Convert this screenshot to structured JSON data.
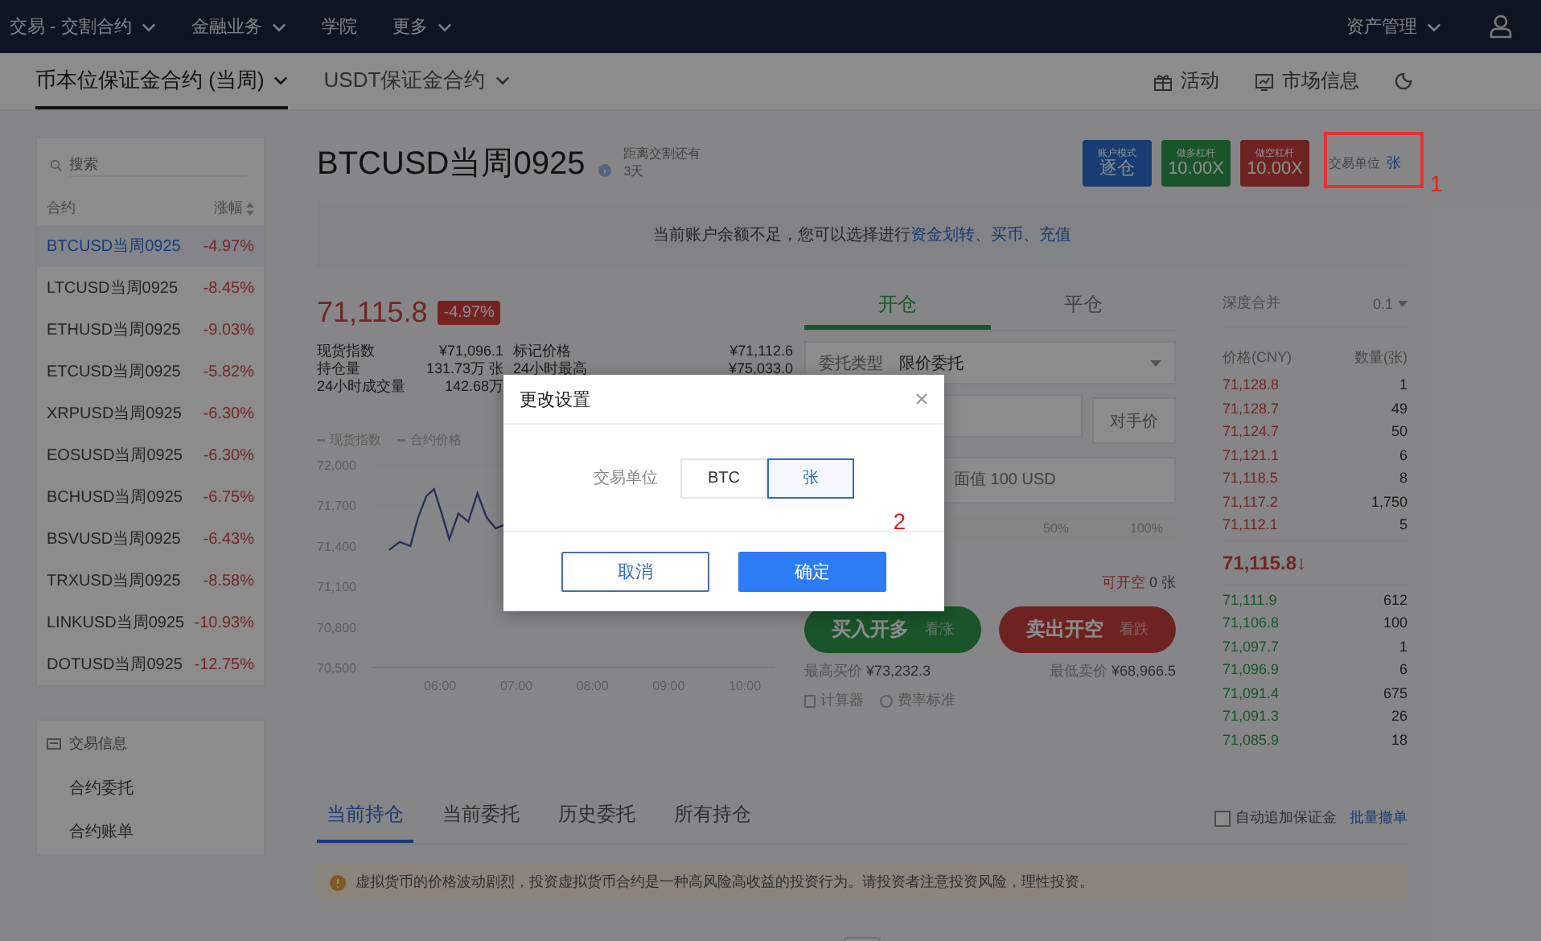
{
  "top_nav": {
    "items": [
      {
        "label": "交易 - 交割合约",
        "dropdown": true
      },
      {
        "label": "金融业务",
        "dropdown": true
      },
      {
        "label": "学院",
        "dropdown": false
      },
      {
        "label": "更多",
        "dropdown": true
      }
    ],
    "account": {
      "label": "资产管理",
      "dropdown": true
    }
  },
  "sub_nav": {
    "tabs": [
      {
        "label": "币本位保证金合约 (当周)",
        "selected": true,
        "dropdown": true
      },
      {
        "label": "USDT保证金合约",
        "selected": false,
        "dropdown": true
      }
    ],
    "links": [
      {
        "label": "活动",
        "kind": "gift"
      },
      {
        "label": "市场信息",
        "kind": "chart"
      }
    ]
  },
  "sidebar": {
    "search": {
      "placeholder": "搜索"
    },
    "columns": [
      "合约",
      "涨幅"
    ],
    "contracts": [
      {
        "name": "BTCUSD当周0925",
        "change": "-4.97%",
        "selected": true
      },
      {
        "name": "LTCUSD当周0925",
        "change": "-8.45%",
        "selected": false
      },
      {
        "name": "ETHUSD当周0925",
        "change": "-9.03%",
        "selected": false
      },
      {
        "name": "ETCUSD当周0925",
        "change": "-5.82%",
        "selected": false
      },
      {
        "name": "XRPUSD当周0925",
        "change": "-6.30%",
        "selected": false
      },
      {
        "name": "EOSUSD当周0925",
        "change": "-6.30%",
        "selected": false
      },
      {
        "name": "BCHUSD当周0925",
        "change": "-6.75%",
        "selected": false
      },
      {
        "name": "BSVUSD当周0925",
        "change": "-6.43%",
        "selected": false
      },
      {
        "name": "TRXUSD当周0925",
        "change": "-8.58%",
        "selected": false
      },
      {
        "name": "LINKUSD当周0925",
        "change": "-10.93%",
        "selected": false
      },
      {
        "name": "DOTUSD当周0925",
        "change": "-12.75%",
        "selected": false
      }
    ],
    "info_panel": {
      "title": "交易信息",
      "items": [
        "合约委托",
        "合约账单"
      ]
    }
  },
  "contract": {
    "title": "BTCUSD当周0925",
    "delivery_label": "距离交割还有",
    "delivery_days": "3天",
    "badges": [
      {
        "kind": "mode",
        "label": "账户模式",
        "value": "逐仓"
      },
      {
        "kind": "long",
        "label": "做多杠杆",
        "value": "10.00X"
      },
      {
        "kind": "short",
        "label": "做空杠杆",
        "value": "10.00X"
      }
    ],
    "unit": {
      "label": "交易单位",
      "value": "张",
      "annotation": "1"
    }
  },
  "notice": {
    "segments": [
      {
        "text": "当前账户余额不足，您可以选择进行",
        "link": false
      },
      {
        "text": "资金划转",
        "link": true
      },
      {
        "text": "、",
        "link": false
      },
      {
        "text": "买币",
        "link": true
      },
      {
        "text": "、",
        "link": false
      },
      {
        "text": "充值",
        "link": true
      }
    ]
  },
  "ticker": {
    "price": "71,115.8",
    "change": "-4.97%",
    "stats": [
      {
        "label": "现货指数",
        "value": "¥71,096.1"
      },
      {
        "label": "标记价格",
        "value": "¥71,112.6"
      },
      {
        "label": "持仓量",
        "value": "131.73万 张"
      },
      {
        "label": "24小时最高",
        "value": "¥75,033.0"
      },
      {
        "label": "24小时成交量",
        "value": "142.68万"
      }
    ]
  },
  "price_chart": {
    "extra_legend": [
      "合约价格"
    ],
    "chart_data": {
      "type": "line",
      "x": [
        5.33,
        5.47,
        5.61,
        5.71,
        5.82,
        5.92,
        6.02,
        6.12,
        6.24,
        6.37,
        6.49,
        6.61,
        6.73,
        6.86
      ],
      "series": [
        {
          "name": "现货指数",
          "color": "#4a5a9a",
          "values": [
            71370,
            71430,
            71400,
            71610,
            71770,
            71820,
            71640,
            71450,
            71640,
            71580,
            71790,
            71610,
            71530,
            71560
          ]
        }
      ],
      "xlim": [
        5.1,
        10.4
      ],
      "ylim": [
        70500,
        72000
      ],
      "xticks": [
        {
          "value": 6,
          "label": "06:00"
        },
        {
          "value": 7,
          "label": "07:00"
        },
        {
          "value": 8,
          "label": "08:00"
        },
        {
          "value": 9,
          "label": "09:00"
        },
        {
          "value": 10,
          "label": "10:00"
        }
      ],
      "yticks": [
        {
          "value": 72000,
          "label": "72,000"
        },
        {
          "value": 71700,
          "label": "71,700"
        },
        {
          "value": 71400,
          "label": "71,400"
        },
        {
          "value": 71100,
          "label": "71,100"
        },
        {
          "value": 70800,
          "label": "70,800"
        },
        {
          "value": 70500,
          "label": "70,500"
        }
      ]
    }
  },
  "order_form": {
    "tabs": [
      {
        "label": "开仓",
        "selected": true
      },
      {
        "label": "平仓",
        "selected": false
      }
    ],
    "order_type": {
      "label": "委托类型",
      "value": "限价委托"
    },
    "counter_price": "对手价",
    "amount_placeholder": "面值 100 USD",
    "percent_marks": [
      "50%",
      "100%"
    ],
    "available": {
      "label": "可开空",
      "value": "0 张"
    },
    "actions": [
      {
        "kind": "buy",
        "label": "买入开多",
        "hint": "看涨"
      },
      {
        "kind": "sell",
        "label": "卖出开空",
        "hint": "看跌"
      }
    ],
    "max_buy": {
      "label": "最高买价",
      "value": "¥73,232.3"
    },
    "min_sell": {
      "label": "最低卖价",
      "value": "¥68,966.5"
    },
    "tools": [
      {
        "kind": "calculator",
        "label": "计算器"
      },
      {
        "kind": "rate",
        "label": "费率标准"
      }
    ]
  },
  "order_book": {
    "merge_label": "深度合并",
    "merge_value": "0.1",
    "columns": [
      "价格(CNY)",
      "数量(张)"
    ],
    "asks": [
      {
        "price": "71,128.8",
        "amount": "1"
      },
      {
        "price": "71,128.7",
        "amount": "49"
      },
      {
        "price": "71,124.7",
        "amount": "50"
      },
      {
        "price": "71,121.1",
        "amount": "6"
      },
      {
        "price": "71,118.5",
        "amount": "8"
      },
      {
        "price": "71,117.2",
        "amount": "1,750"
      },
      {
        "price": "71,112.1",
        "amount": "5"
      }
    ],
    "last_price": "71,115.8↓",
    "bids": [
      {
        "price": "71,111.9",
        "amount": "612"
      },
      {
        "price": "71,106.8",
        "amount": "100"
      },
      {
        "price": "71,097.7",
        "amount": "1"
      },
      {
        "price": "71,096.9",
        "amount": "6"
      },
      {
        "price": "71,091.4",
        "amount": "675"
      },
      {
        "price": "71,091.3",
        "amount": "26"
      },
      {
        "price": "71,085.9",
        "amount": "18"
      }
    ]
  },
  "positions": {
    "tabs": [
      {
        "label": "当前持仓",
        "selected": true
      },
      {
        "label": "当前委托",
        "selected": false
      },
      {
        "label": "历史委托",
        "selected": false
      },
      {
        "label": "所有持仓",
        "selected": false
      }
    ],
    "auto_margin": {
      "label": "自动追加保证金",
      "checked": false
    },
    "cancel_all": "批量撤单",
    "warning": "虚拟货币的价格波动剧烈，投资虚拟货币合约是一种高风险高收益的投资行为。请投资者注意投资风险，理性投资。"
  },
  "dialog": {
    "title": "更改设置",
    "field_label": "交易单位",
    "options": [
      {
        "label": "BTC",
        "selected": false
      },
      {
        "label": "张",
        "selected": true
      }
    ],
    "buttons": [
      {
        "label": "取消",
        "kind": "secondary"
      },
      {
        "label": "确定",
        "kind": "primary"
      }
    ],
    "annotation": "2"
  }
}
